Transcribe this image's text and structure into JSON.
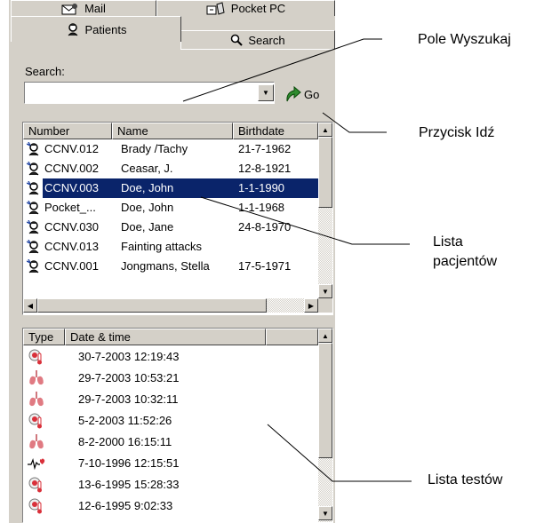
{
  "tabs": {
    "back": [
      {
        "id": "mail",
        "label": "Mail",
        "icon": "mail-icon"
      },
      {
        "id": "pocketpc",
        "label": "Pocket PC",
        "icon": "pocket-pc-icon"
      }
    ],
    "front": [
      {
        "id": "patients",
        "label": "Patients",
        "icon": "patient-icon",
        "active": true
      },
      {
        "id": "search",
        "label": "Search",
        "icon": "magnifier-icon",
        "active": false
      }
    ]
  },
  "search": {
    "label": "Search:",
    "value": "",
    "go_label": "Go"
  },
  "patients_list": {
    "columns": [
      "Number",
      "Name",
      "Birthdate"
    ],
    "rows": [
      {
        "number": "CCNV.012",
        "name": "Brady /Tachy",
        "birthdate": "21-7-1962",
        "selected": false
      },
      {
        "number": "CCNV.002",
        "name": "Ceasar, J.",
        "birthdate": "12-8-1921",
        "selected": false
      },
      {
        "number": "CCNV.003",
        "name": "Doe, John",
        "birthdate": "1-1-1990",
        "selected": true
      },
      {
        "number": "Pocket_...",
        "name": "Doe, John",
        "birthdate": "1-1-1968",
        "selected": false
      },
      {
        "number": "CCNV.030",
        "name": "Doe, Jane",
        "birthdate": "24-8-1970",
        "selected": false
      },
      {
        "number": "CCNV.013",
        "name": "Fainting attacks",
        "birthdate": "",
        "selected": false
      },
      {
        "number": "CCNV.001",
        "name": "Jongmans, Stella",
        "birthdate": "17-5-1971",
        "selected": false
      }
    ]
  },
  "tests_list": {
    "columns": [
      "Type",
      "Date & time"
    ],
    "rows": [
      {
        "icon": "thermometer-icon",
        "datetime": "30-7-2003 12:19:43"
      },
      {
        "icon": "lungs-icon",
        "datetime": "29-7-2003 10:53:21"
      },
      {
        "icon": "lungs-icon",
        "datetime": "29-7-2003 10:32:11"
      },
      {
        "icon": "thermometer-icon",
        "datetime": "5-2-2003 11:52:26"
      },
      {
        "icon": "lungs-icon",
        "datetime": "8-2-2000 16:15:11"
      },
      {
        "icon": "ecg-heart-icon",
        "datetime": "7-10-1996 12:15:51"
      },
      {
        "icon": "thermometer-icon",
        "datetime": "13-6-1995 15:28:33"
      },
      {
        "icon": "thermometer-icon",
        "datetime": "12-6-1995 9:02:33"
      }
    ]
  },
  "callouts": {
    "search_field": "Pole Wyszukaj",
    "go_button": "Przycisk Idź",
    "patients_list_line1": "Lista",
    "patients_list_line2": "pacjentów",
    "tests_list": "Lista testów"
  },
  "colors": {
    "window_face": "#d4d0c8",
    "selection": "#0a246a",
    "go_arrow": "#2e8b2e",
    "test_icon_red": "#d9303a"
  }
}
